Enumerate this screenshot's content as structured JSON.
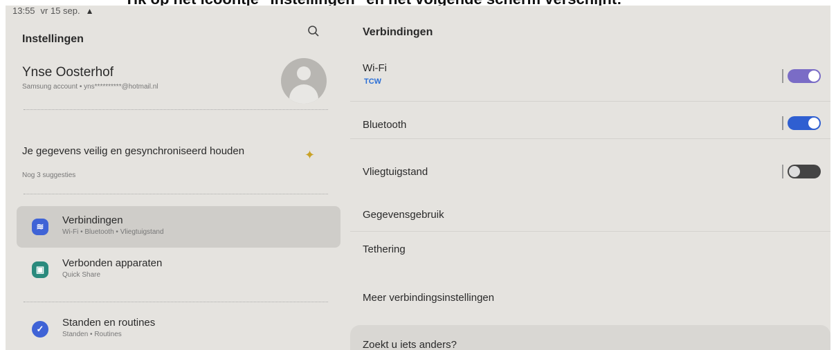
{
  "banner": {
    "text": "Tik op het icoontje \"Instellingen\" en het volgende scherm verschijnt:"
  },
  "statusbar": {
    "time": "13:55",
    "date": "vr 15 sep.",
    "warning_icon": "warning-triangle-icon"
  },
  "left": {
    "title": "Instellingen",
    "search_icon": "search-icon",
    "profile": {
      "name": "Ynse Oosterhof",
      "subtitle": "Samsung account • yns**********@hotmail.nl"
    },
    "suggestion": {
      "title": "Je gegevens veilig en gesynchroniseerd houden",
      "subtitle": "Nog 3 suggesties"
    },
    "menu": [
      {
        "title": "Verbindingen",
        "subtitle": "Wi-Fi • Bluetooth • Vliegtuigstand",
        "icon": "wifi-icon",
        "color": "#3f63d6"
      },
      {
        "title": "Verbonden apparaten",
        "subtitle": "Quick Share",
        "icon": "devices-icon",
        "color": "#2a8a7d"
      },
      {
        "title": "Standen en routines",
        "subtitle": "Standen • Routines",
        "icon": "routines-icon",
        "color": "#3f63d6"
      }
    ]
  },
  "right": {
    "title": "Verbindingen",
    "rows": [
      {
        "label": "Wi-Fi",
        "sub": "TCW",
        "toggle": "on"
      },
      {
        "label": "Bluetooth",
        "toggle": "on"
      },
      {
        "label": "Vliegtuigstand",
        "toggle": "off"
      },
      {
        "label": "Gegevensgebruik"
      },
      {
        "label": "Tethering"
      },
      {
        "label": "Meer verbindingsinstellingen"
      }
    ],
    "find": "Zoekt u iets anders?"
  },
  "colors": {
    "toggle_wifi": "#7a6cc6",
    "toggle_bluetooth": "#2f5fd1",
    "toggle_off": "#444444"
  }
}
